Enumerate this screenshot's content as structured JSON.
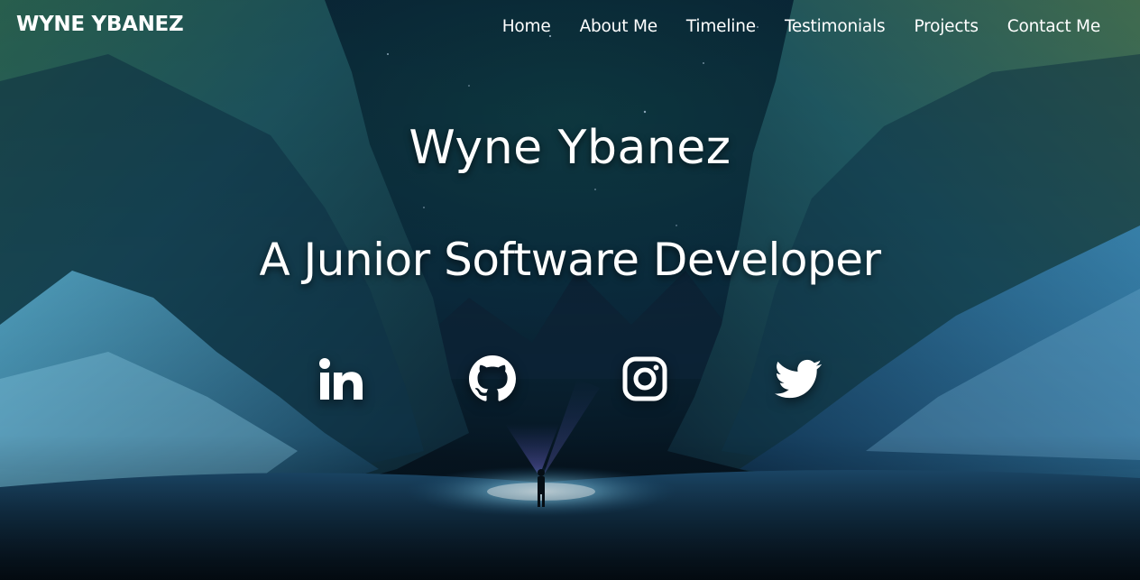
{
  "site": {
    "brand": "WYNE YBANEZ"
  },
  "nav": {
    "items": [
      {
        "label": "Home"
      },
      {
        "label": "About Me"
      },
      {
        "label": "Timeline"
      },
      {
        "label": "Testimonials"
      },
      {
        "label": "Projects"
      },
      {
        "label": "Contact Me"
      }
    ]
  },
  "hero": {
    "name": "Wyne Ybanez",
    "role": "A Junior Software Developer",
    "background": "night canyon with snow and a lone figure holding a light"
  },
  "social": [
    {
      "icon": "linkedin-icon"
    },
    {
      "icon": "github-icon"
    },
    {
      "icon": "instagram-icon"
    },
    {
      "icon": "twitter-icon"
    }
  ],
  "colors": {
    "text": "#ffffff",
    "sky": "#0a2a3d",
    "cliff_glow": "#3fb8c8",
    "snow": "#7fc8e8",
    "light_beam": "#cfefff"
  }
}
